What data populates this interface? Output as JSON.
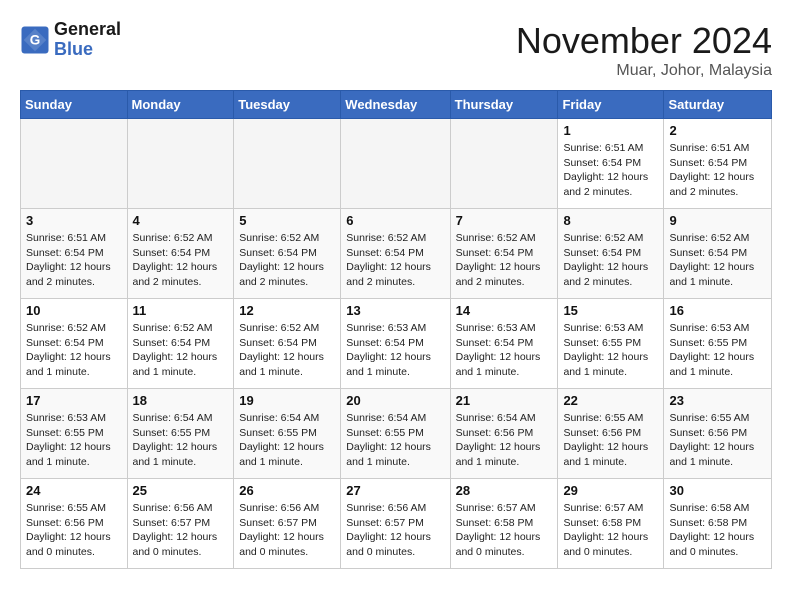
{
  "header": {
    "logo_general": "General",
    "logo_blue": "Blue",
    "month_title": "November 2024",
    "location": "Muar, Johor, Malaysia"
  },
  "calendar": {
    "days_of_week": [
      "Sunday",
      "Monday",
      "Tuesday",
      "Wednesday",
      "Thursday",
      "Friday",
      "Saturday"
    ],
    "weeks": [
      [
        {
          "day": "",
          "empty": true
        },
        {
          "day": "",
          "empty": true
        },
        {
          "day": "",
          "empty": true
        },
        {
          "day": "",
          "empty": true
        },
        {
          "day": "",
          "empty": true
        },
        {
          "day": "1",
          "sunrise": "Sunrise: 6:51 AM",
          "sunset": "Sunset: 6:54 PM",
          "daylight": "Daylight: 12 hours and 2 minutes."
        },
        {
          "day": "2",
          "sunrise": "Sunrise: 6:51 AM",
          "sunset": "Sunset: 6:54 PM",
          "daylight": "Daylight: 12 hours and 2 minutes."
        }
      ],
      [
        {
          "day": "3",
          "sunrise": "Sunrise: 6:51 AM",
          "sunset": "Sunset: 6:54 PM",
          "daylight": "Daylight: 12 hours and 2 minutes."
        },
        {
          "day": "4",
          "sunrise": "Sunrise: 6:52 AM",
          "sunset": "Sunset: 6:54 PM",
          "daylight": "Daylight: 12 hours and 2 minutes."
        },
        {
          "day": "5",
          "sunrise": "Sunrise: 6:52 AM",
          "sunset": "Sunset: 6:54 PM",
          "daylight": "Daylight: 12 hours and 2 minutes."
        },
        {
          "day": "6",
          "sunrise": "Sunrise: 6:52 AM",
          "sunset": "Sunset: 6:54 PM",
          "daylight": "Daylight: 12 hours and 2 minutes."
        },
        {
          "day": "7",
          "sunrise": "Sunrise: 6:52 AM",
          "sunset": "Sunset: 6:54 PM",
          "daylight": "Daylight: 12 hours and 2 minutes."
        },
        {
          "day": "8",
          "sunrise": "Sunrise: 6:52 AM",
          "sunset": "Sunset: 6:54 PM",
          "daylight": "Daylight: 12 hours and 2 minutes."
        },
        {
          "day": "9",
          "sunrise": "Sunrise: 6:52 AM",
          "sunset": "Sunset: 6:54 PM",
          "daylight": "Daylight: 12 hours and 1 minute."
        }
      ],
      [
        {
          "day": "10",
          "sunrise": "Sunrise: 6:52 AM",
          "sunset": "Sunset: 6:54 PM",
          "daylight": "Daylight: 12 hours and 1 minute."
        },
        {
          "day": "11",
          "sunrise": "Sunrise: 6:52 AM",
          "sunset": "Sunset: 6:54 PM",
          "daylight": "Daylight: 12 hours and 1 minute."
        },
        {
          "day": "12",
          "sunrise": "Sunrise: 6:52 AM",
          "sunset": "Sunset: 6:54 PM",
          "daylight": "Daylight: 12 hours and 1 minute."
        },
        {
          "day": "13",
          "sunrise": "Sunrise: 6:53 AM",
          "sunset": "Sunset: 6:54 PM",
          "daylight": "Daylight: 12 hours and 1 minute."
        },
        {
          "day": "14",
          "sunrise": "Sunrise: 6:53 AM",
          "sunset": "Sunset: 6:54 PM",
          "daylight": "Daylight: 12 hours and 1 minute."
        },
        {
          "day": "15",
          "sunrise": "Sunrise: 6:53 AM",
          "sunset": "Sunset: 6:55 PM",
          "daylight": "Daylight: 12 hours and 1 minute."
        },
        {
          "day": "16",
          "sunrise": "Sunrise: 6:53 AM",
          "sunset": "Sunset: 6:55 PM",
          "daylight": "Daylight: 12 hours and 1 minute."
        }
      ],
      [
        {
          "day": "17",
          "sunrise": "Sunrise: 6:53 AM",
          "sunset": "Sunset: 6:55 PM",
          "daylight": "Daylight: 12 hours and 1 minute."
        },
        {
          "day": "18",
          "sunrise": "Sunrise: 6:54 AM",
          "sunset": "Sunset: 6:55 PM",
          "daylight": "Daylight: 12 hours and 1 minute."
        },
        {
          "day": "19",
          "sunrise": "Sunrise: 6:54 AM",
          "sunset": "Sunset: 6:55 PM",
          "daylight": "Daylight: 12 hours and 1 minute."
        },
        {
          "day": "20",
          "sunrise": "Sunrise: 6:54 AM",
          "sunset": "Sunset: 6:55 PM",
          "daylight": "Daylight: 12 hours and 1 minute."
        },
        {
          "day": "21",
          "sunrise": "Sunrise: 6:54 AM",
          "sunset": "Sunset: 6:56 PM",
          "daylight": "Daylight: 12 hours and 1 minute."
        },
        {
          "day": "22",
          "sunrise": "Sunrise: 6:55 AM",
          "sunset": "Sunset: 6:56 PM",
          "daylight": "Daylight: 12 hours and 1 minute."
        },
        {
          "day": "23",
          "sunrise": "Sunrise: 6:55 AM",
          "sunset": "Sunset: 6:56 PM",
          "daylight": "Daylight: 12 hours and 1 minute."
        }
      ],
      [
        {
          "day": "24",
          "sunrise": "Sunrise: 6:55 AM",
          "sunset": "Sunset: 6:56 PM",
          "daylight": "Daylight: 12 hours and 0 minutes."
        },
        {
          "day": "25",
          "sunrise": "Sunrise: 6:56 AM",
          "sunset": "Sunset: 6:57 PM",
          "daylight": "Daylight: 12 hours and 0 minutes."
        },
        {
          "day": "26",
          "sunrise": "Sunrise: 6:56 AM",
          "sunset": "Sunset: 6:57 PM",
          "daylight": "Daylight: 12 hours and 0 minutes."
        },
        {
          "day": "27",
          "sunrise": "Sunrise: 6:56 AM",
          "sunset": "Sunset: 6:57 PM",
          "daylight": "Daylight: 12 hours and 0 minutes."
        },
        {
          "day": "28",
          "sunrise": "Sunrise: 6:57 AM",
          "sunset": "Sunset: 6:58 PM",
          "daylight": "Daylight: 12 hours and 0 minutes."
        },
        {
          "day": "29",
          "sunrise": "Sunrise: 6:57 AM",
          "sunset": "Sunset: 6:58 PM",
          "daylight": "Daylight: 12 hours and 0 minutes."
        },
        {
          "day": "30",
          "sunrise": "Sunrise: 6:58 AM",
          "sunset": "Sunset: 6:58 PM",
          "daylight": "Daylight: 12 hours and 0 minutes."
        }
      ]
    ]
  }
}
